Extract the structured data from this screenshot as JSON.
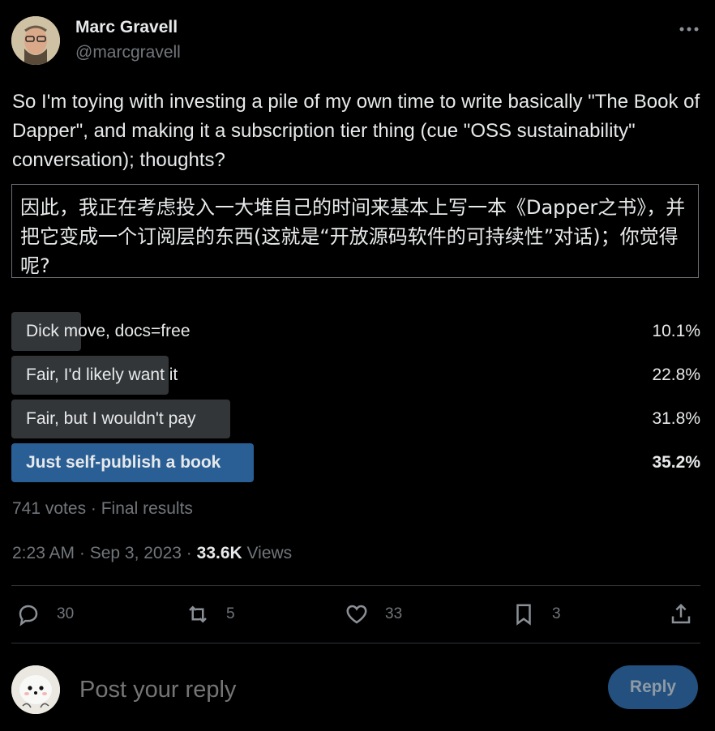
{
  "author": {
    "name": "Marc Gravell",
    "handle": "@marcgravell"
  },
  "tweet": {
    "text": "So I'm toying with investing a pile of my own time to write basically \"The Book of Dapper\", and making it a subscription tier thing (cue \"OSS sustainability\" conversation); thoughts?",
    "translation": "因此，我正在考虑投入一大堆自己的时间来基本上写一本《Dapper之书》，并把它变成一个订阅层的东西(这就是“开放源码软件的可持续性”对话)；你觉得呢?"
  },
  "poll": {
    "options": [
      {
        "label": "Dick move, docs=free",
        "percent": "10.1%",
        "share": 0.101,
        "winner": false
      },
      {
        "label": "Fair, I'd likely want it",
        "percent": "22.8%",
        "share": 0.228,
        "winner": false
      },
      {
        "label": "Fair, but I wouldn't pay",
        "percent": "31.8%",
        "share": 0.318,
        "winner": false
      },
      {
        "label": "Just self-publish a book",
        "percent": "35.2%",
        "share": 0.352,
        "winner": true
      }
    ],
    "summary": "741 votes · Final results"
  },
  "meta": {
    "time": "2:23 AM · Sep 3, 2023 · ",
    "views_count": "33.6K",
    "views_label": " Views"
  },
  "actions": {
    "replies": "30",
    "retweets": "5",
    "likes": "33",
    "bookmarks": "3"
  },
  "reply": {
    "placeholder": "Post your reply",
    "button_label": "Reply"
  },
  "colors": {
    "winner_bar": "#2a5f95",
    "option_bar": "#333639",
    "reply_button": "#23507e"
  }
}
